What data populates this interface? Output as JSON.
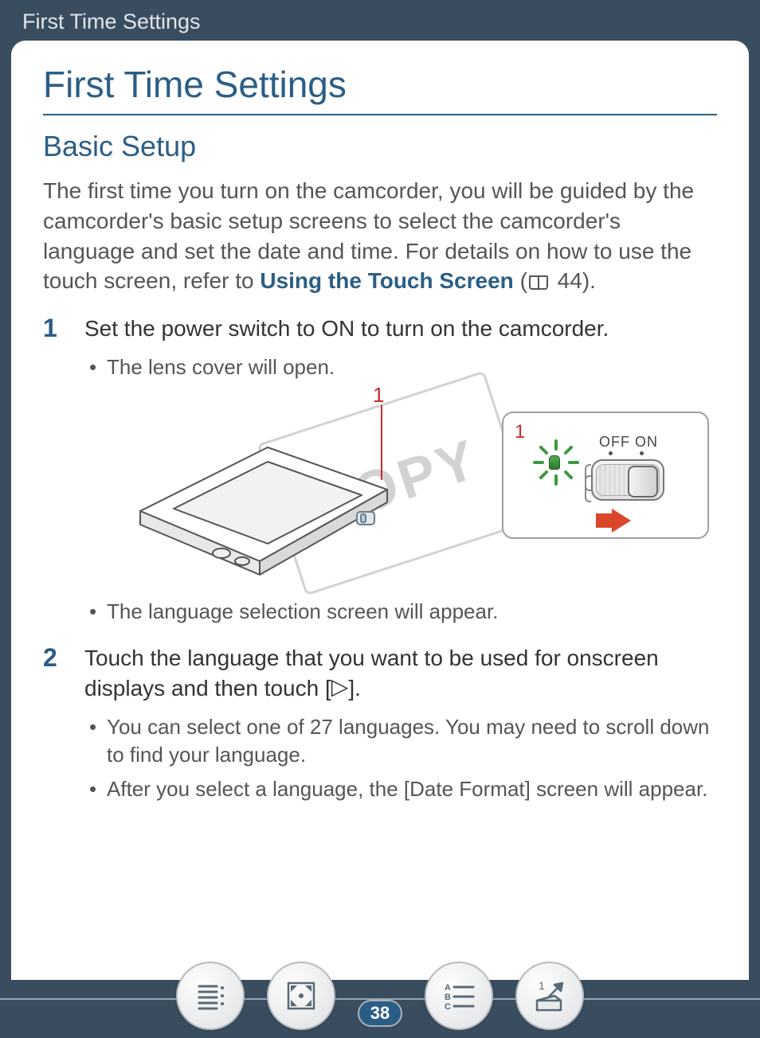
{
  "header": {
    "breadcrumb": "First Time Settings"
  },
  "title": "First Time Settings",
  "section": "Basic Setup",
  "intro": {
    "pre": "The first time you turn on the camcorder, you will be guided by the camcorder's basic setup screens to select the camcorder's language and set the date and time. For details on how to use the touch screen, refer to ",
    "link": "Using the Touch Screen",
    "post_open": " (",
    "ref": " 44).",
    "link_page": "44"
  },
  "steps": [
    {
      "num": "1",
      "text": "Set the power switch to ON to turn on the camcorder.",
      "bullets_before": [
        "The lens cover will open."
      ],
      "bullets_after": [
        "The language selection screen will appear."
      ]
    },
    {
      "num": "2",
      "text_pre": "Touch the language that you want to be used for onscreen displays and then touch [",
      "text_post": "].",
      "bullets": [
        "You can select one of 27 languages. You may need to scroll down to find your language.",
        "After you select a language, the [Date Format] screen will appear."
      ]
    }
  ],
  "illustration": {
    "callout_left": "1",
    "callout_right": "1",
    "switch_label": "OFF ON",
    "watermark": "COPY"
  },
  "nav": {
    "page": "38",
    "buttons": [
      "toc",
      "expand",
      "index",
      "top"
    ]
  }
}
